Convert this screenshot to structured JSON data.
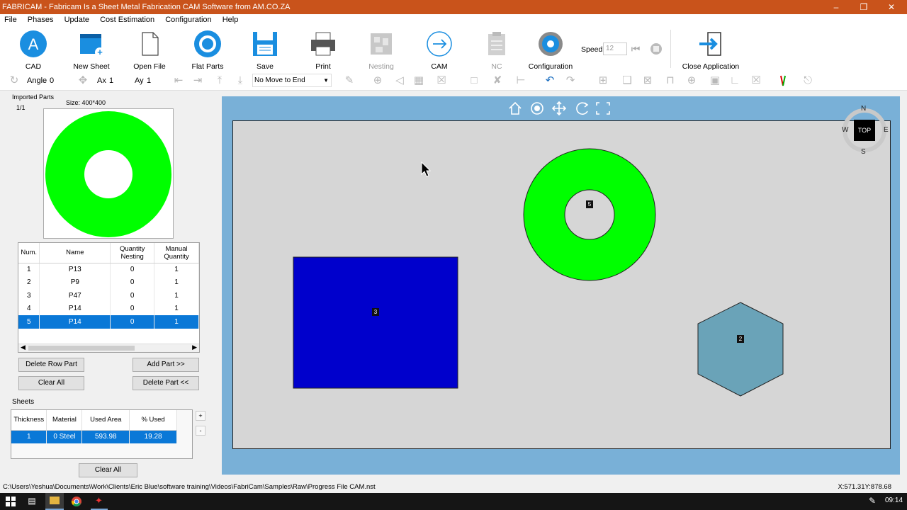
{
  "window": {
    "title": "FABRICAM - Fabricam Is a Sheet Metal Fabrication CAM Software from AM.CO.ZA"
  },
  "menu": [
    "File",
    "Phases",
    "Update",
    "Cost Estimation",
    "Configuration",
    "Help"
  ],
  "ribbon": {
    "cad": "CAD",
    "new_sheet": "New Sheet",
    "open_file": "Open File",
    "flat_parts": "Flat Parts",
    "save": "Save",
    "print": "Print",
    "nesting": "Nesting",
    "cam": "CAM",
    "nc": "NC",
    "configuration": "Configuration",
    "speed_label": "Speed",
    "speed_value": "12",
    "close_application": "Close Application"
  },
  "toolbar2": {
    "angle_label": "Angle",
    "angle_value": "0",
    "ax_label": "Ax",
    "ax_value": "1",
    "ay_label": "Ay",
    "ay_value": "1",
    "move_select": "No Move to End"
  },
  "imported_parts": {
    "title": "Imported Parts",
    "counter": "1/1",
    "size": "Size: 400*400"
  },
  "parts_table": {
    "headers": {
      "num": "Num.",
      "name": "Name",
      "qty_nesting": "Quantity Nesting",
      "manual_qty": "Manual Quantity"
    },
    "rows": [
      {
        "num": "1",
        "name": "P13",
        "qty_nesting": "0",
        "manual_qty": "1"
      },
      {
        "num": "2",
        "name": "P9",
        "qty_nesting": "0",
        "manual_qty": "1"
      },
      {
        "num": "3",
        "name": "P47",
        "qty_nesting": "0",
        "manual_qty": "1"
      },
      {
        "num": "4",
        "name": "P14",
        "qty_nesting": "0",
        "manual_qty": "1"
      },
      {
        "num": "5",
        "name": "P14",
        "qty_nesting": "0",
        "manual_qty": "1"
      }
    ]
  },
  "buttons": {
    "delete_row_part": "Delete Row Part",
    "add_part": "Add Part >>",
    "clear_all": "Clear All",
    "delete_part": "Delete Part <<",
    "sheets_clear_all": "Clear All"
  },
  "sheets": {
    "title": "Sheets",
    "headers": {
      "thickness": "Thickness",
      "material": "Material",
      "used_area": "Used Area",
      "pct_used": "% Used"
    },
    "row": {
      "thickness": "1",
      "material": "0  Steel",
      "used_area": "593.98",
      "pct_used": "19.28"
    }
  },
  "canvas": {
    "compass": {
      "n": "N",
      "s": "S",
      "e": "E",
      "w": "W",
      "view": "TOP"
    },
    "markers": {
      "rect": "3",
      "ring": "5",
      "hex": "2"
    },
    "colors": {
      "ring": "#00ff00",
      "rect": "#0000cc",
      "hex": "#6aa3b8",
      "sheet": "#d6d6d6"
    }
  },
  "status": {
    "path": "C:\\Users\\Yeshua\\Documents\\Work\\Clients\\Eric Blue\\software training\\Videos\\FabriCam\\Samples\\Raw\\Progress File CAM.nst",
    "coords": "X:571.31Y:878.68"
  },
  "taskbar": {
    "time": "09:14"
  }
}
